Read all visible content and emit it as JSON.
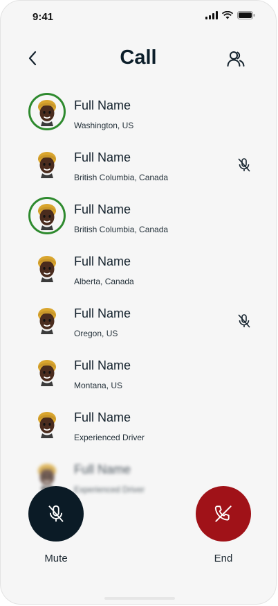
{
  "status_bar": {
    "time": "9:41"
  },
  "header": {
    "title": "Call"
  },
  "participants": [
    {
      "name": "Full Name",
      "location": "Washington, US",
      "speaking": true,
      "muted": false
    },
    {
      "name": "Full Name",
      "location": "British Columbia, Canada",
      "speaking": false,
      "muted": true
    },
    {
      "name": "Full Name",
      "location": "British Columbia, Canada",
      "speaking": true,
      "muted": false
    },
    {
      "name": "Full Name",
      "location": "Alberta, Canada",
      "speaking": false,
      "muted": false
    },
    {
      "name": "Full Name",
      "location": "Oregon, US",
      "speaking": false,
      "muted": true
    },
    {
      "name": "Full Name",
      "location": "Montana, US",
      "speaking": false,
      "muted": false
    },
    {
      "name": "Full Name",
      "location": "Experienced Driver",
      "speaking": false,
      "muted": false
    },
    {
      "name": "Full Name",
      "location": "Experienced Driver",
      "speaking": false,
      "muted": false
    }
  ],
  "controls": {
    "mute_label": "Mute",
    "end_label": "End"
  },
  "colors": {
    "speaking_ring": "#2e8a2e",
    "mute_button": "#0b1b26",
    "end_button": "#a01218"
  },
  "icons": [
    "back-icon",
    "participants-icon",
    "muted-mic-icon",
    "end-call-icon"
  ]
}
